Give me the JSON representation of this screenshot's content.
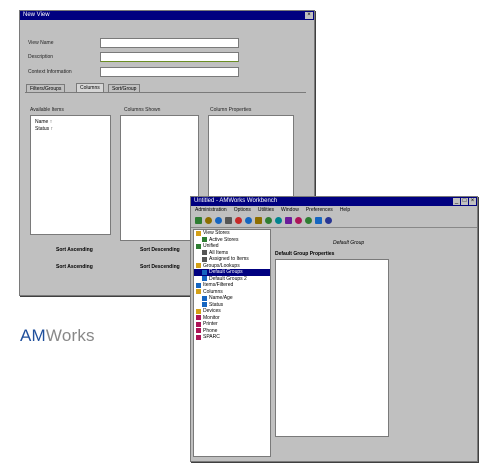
{
  "brand": {
    "logo_prefix": "AM",
    "logo_suffix": "Works",
    "prefix_color": "#1f4f9c",
    "suffix_color": "#888888"
  },
  "back_window": {
    "title": "New View",
    "form": [
      {
        "label": "View Name",
        "value": ""
      },
      {
        "label": "Description",
        "value": ""
      },
      {
        "label": "Context Information",
        "value": ""
      }
    ],
    "tabs": [
      "Filters/Groups",
      "Columns",
      "Sort/Group"
    ],
    "active_tab": 1,
    "panel_headers": [
      "Available Items",
      "Columns Shown",
      "Column Properties"
    ],
    "available_items": [
      "Name  ↑",
      "Status  ↑"
    ],
    "bottom_labels": [
      "Sort Ascending",
      "Sort Descending",
      "Sort Ascending",
      "Sort Descending"
    ]
  },
  "front_window": {
    "title": "Untitled - AMWorks Workbench",
    "menu": [
      "Administration",
      "Options",
      "Utilities",
      "Window",
      "Preferences",
      "Help"
    ],
    "toolbar_icons": [
      "new-icon",
      "open-icon",
      "save-icon",
      "print-icon",
      "cut-icon",
      "copy-icon",
      "paste-icon",
      "undo-icon",
      "refresh-icon",
      "find-icon",
      "filter-icon",
      "chart-icon",
      "grid-icon",
      "help-icon"
    ],
    "tree": [
      {
        "label": "View Stores",
        "icon": "folder-icon",
        "level": 0,
        "selected": false
      },
      {
        "label": "Active Stores",
        "icon": "store-icon",
        "level": 1,
        "selected": false
      },
      {
        "label": "Unified",
        "icon": "store-icon",
        "level": 0,
        "selected": false
      },
      {
        "label": "All Items",
        "icon": "list-icon",
        "level": 1,
        "selected": false
      },
      {
        "label": "Assigned to Items",
        "icon": "list-icon",
        "level": 1,
        "selected": false
      },
      {
        "label": "Groups/Lookups",
        "icon": "folder-icon",
        "level": 0,
        "selected": false
      },
      {
        "label": "Default Groups",
        "icon": "group-icon",
        "level": 1,
        "selected": true
      },
      {
        "label": "Default Groups 2",
        "icon": "group-icon",
        "level": 1,
        "selected": false
      },
      {
        "label": "Items/Filtered",
        "icon": "group-icon",
        "level": 0,
        "selected": false
      },
      {
        "label": "Columns",
        "icon": "folder-icon",
        "level": 0,
        "selected": false
      },
      {
        "label": "Name/Age",
        "icon": "group-icon",
        "level": 1,
        "selected": false
      },
      {
        "label": "Status",
        "icon": "group-icon",
        "level": 1,
        "selected": false
      },
      {
        "label": "Devices",
        "icon": "folder-icon",
        "level": 0,
        "selected": false
      },
      {
        "label": "Monitor",
        "icon": "device-icon",
        "level": 0,
        "selected": false
      },
      {
        "label": "Printer",
        "icon": "device-icon",
        "level": 0,
        "selected": false
      },
      {
        "label": "Phone",
        "icon": "device-icon",
        "level": 0,
        "selected": false
      },
      {
        "label": "SPARC",
        "icon": "device-icon",
        "level": 0,
        "selected": false
      }
    ],
    "content_title": "Default Group",
    "content_subtitle": "Default Group Properties"
  }
}
